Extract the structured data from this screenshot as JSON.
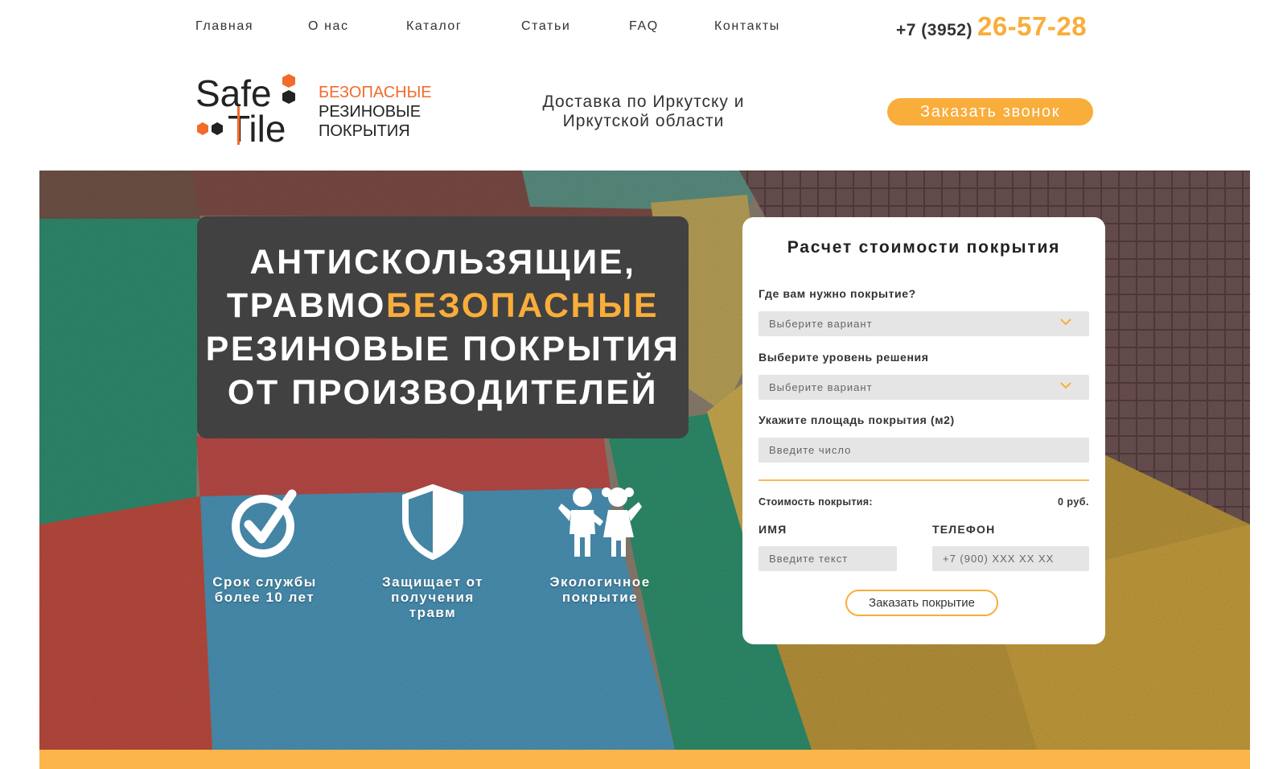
{
  "nav": {
    "items": [
      "Главная",
      "О нас",
      "Каталог",
      "Статьи",
      "FAQ",
      "Контакты"
    ]
  },
  "phone": {
    "code": "+7 (3952)",
    "number": "26-57-28"
  },
  "logo": {
    "brand_line1": "Safe",
    "brand_line2": "Tile",
    "tagline": [
      "БЕЗОПАСНЫЕ",
      "РЕЗИНОВЫЕ",
      "ПОКРЫТИЯ"
    ]
  },
  "delivery": [
    "Доставка по Иркутску и",
    "Иркутской области"
  ],
  "call_button": "Заказать звонок",
  "hero": {
    "headline": {
      "line1": "АНТИСКОЛЬЗЯЩИЕ,",
      "line2_plain": "ТРАВМО",
      "line2_highlight": "БЕЗОПАСНЫЕ",
      "line3": "РЕЗИНОВЫЕ ПОКРЫТИЯ",
      "line4": "ОТ ПРОИЗВОДИТЕЛЕЙ"
    },
    "features": [
      {
        "icon": "clock-check-icon",
        "caption": [
          "Срок службы",
          "более 10 лет"
        ]
      },
      {
        "icon": "shield-icon",
        "caption": [
          "Защищает от",
          "получения",
          "травм"
        ]
      },
      {
        "icon": "children-icon",
        "caption": [
          "Экологичное",
          "покрытие"
        ]
      }
    ]
  },
  "calculator": {
    "title": "Расчет стоимости покрытия",
    "q1_label": "Где вам нужно покрытие?",
    "q1_value": "Выберите вариант",
    "q2_label": "Выберите уровень решения",
    "q2_value": "Выберите вариант",
    "q3_label": "Укажите площадь покрытия (м2)",
    "q3_placeholder": "Введите число",
    "cost_label": "Стоимость покрытия:",
    "cost_value": "0 руб.",
    "name_label": "ИМЯ",
    "name_placeholder": "Введите текст",
    "phone_label": "ТЕЛЕФОН",
    "phone_placeholder": "+7 (900) XXX XX XX",
    "submit": "Заказать покрытие"
  },
  "colors": {
    "accent": "#f9ad3a",
    "logo_orange": "#f26b2d",
    "headline_bg": "#414141"
  }
}
